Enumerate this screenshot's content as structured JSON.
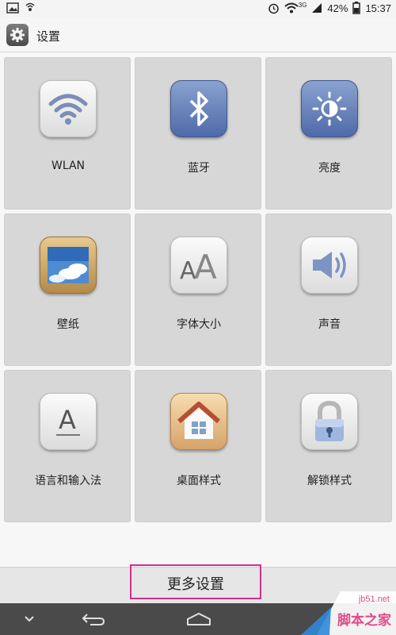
{
  "status_bar": {
    "battery": "42%",
    "time": "15:37",
    "network": "3G"
  },
  "header": {
    "title": "设置",
    "icon": "gear-icon"
  },
  "tiles": [
    {
      "label": "WLAN",
      "icon": "wifi-icon"
    },
    {
      "label": "蓝牙",
      "icon": "bluetooth-icon"
    },
    {
      "label": "亮度",
      "icon": "brightness-icon"
    },
    {
      "label": "壁纸",
      "icon": "wallpaper-icon"
    },
    {
      "label": "字体大小",
      "icon": "font-size-icon"
    },
    {
      "label": "声音",
      "icon": "sound-icon"
    },
    {
      "label": "语言和输入法",
      "icon": "language-icon"
    },
    {
      "label": "桌面样式",
      "icon": "home-style-icon"
    },
    {
      "label": "解锁样式",
      "icon": "lock-icon"
    }
  ],
  "footer": {
    "more_label": "更多设置"
  },
  "watermark": {
    "site": "jb51.net",
    "name": "脚本之家"
  },
  "colors": {
    "highlight": "#d0308a",
    "tile_bg": "#d7d7d7"
  }
}
